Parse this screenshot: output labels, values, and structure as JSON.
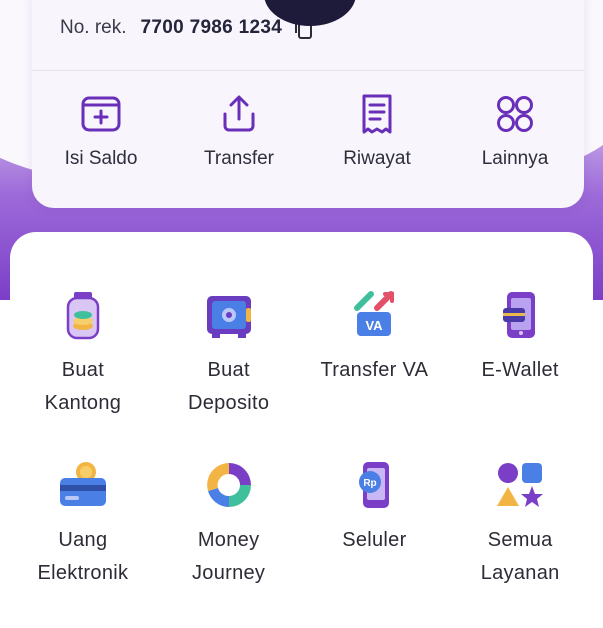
{
  "account": {
    "label": "No. rek.",
    "number": "7700 7986 1234"
  },
  "quick_actions": [
    {
      "label": "Isi Saldo",
      "icon": "top-up-icon"
    },
    {
      "label": "Transfer",
      "icon": "upload-icon"
    },
    {
      "label": "Riwayat",
      "icon": "receipt-icon"
    },
    {
      "label": "Lainnya",
      "icon": "grid-icon"
    }
  ],
  "services": [
    {
      "line1": "Buat",
      "line2": "Kantong",
      "icon": "jar-icon"
    },
    {
      "line1": "Buat",
      "line2": "Deposito",
      "icon": "safe-icon"
    },
    {
      "line1": "Transfer VA",
      "line2": "",
      "icon": "va-transfer-icon"
    },
    {
      "line1": "E-Wallet",
      "line2": "",
      "icon": "ewallet-icon"
    },
    {
      "line1": "Uang",
      "line2": "Elektronik",
      "icon": "card-coin-icon"
    },
    {
      "line1": "Money",
      "line2": "Journey",
      "icon": "donut-chart-icon"
    },
    {
      "line1": "Seluler",
      "line2": "",
      "icon": "phone-icon"
    },
    {
      "line1": "Semua",
      "line2": "Layanan",
      "icon": "shapes-icon"
    }
  ],
  "colors": {
    "brand": "#7b3fc7",
    "icon_stroke": "#6a2fb8",
    "text": "#2c2c36"
  }
}
